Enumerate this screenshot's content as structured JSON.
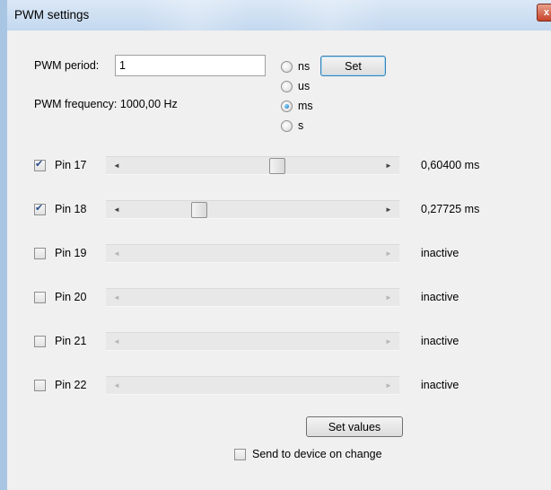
{
  "window": {
    "title": "PWM settings",
    "close_glyph": "x"
  },
  "period": {
    "label": "PWM period:",
    "value": "1"
  },
  "frequency": {
    "label": "PWM frequency: 1000,00 Hz"
  },
  "units": [
    {
      "label": "ns",
      "checked": false
    },
    {
      "label": "us",
      "checked": false
    },
    {
      "label": "ms",
      "checked": true
    },
    {
      "label": "s",
      "checked": false
    }
  ],
  "set_label": "Set",
  "pins": [
    {
      "label": "Pin 17",
      "checked": true,
      "value": "0,60400 ms",
      "level": 0.604
    },
    {
      "label": "Pin 18",
      "checked": true,
      "value": "0,27725 ms",
      "level": 0.277
    },
    {
      "label": "Pin 19",
      "checked": false,
      "value": "inactive",
      "level": null
    },
    {
      "label": "Pin 20",
      "checked": false,
      "value": "inactive",
      "level": null
    },
    {
      "label": "Pin 21",
      "checked": false,
      "value": "inactive",
      "level": null
    },
    {
      "label": "Pin 22",
      "checked": false,
      "value": "inactive",
      "level": null
    }
  ],
  "set_values_label": "Set values",
  "send_on_change": {
    "label": "Send to device on change",
    "checked": false
  },
  "icons": {
    "scroll_left": "◄",
    "scroll_right": "►"
  }
}
